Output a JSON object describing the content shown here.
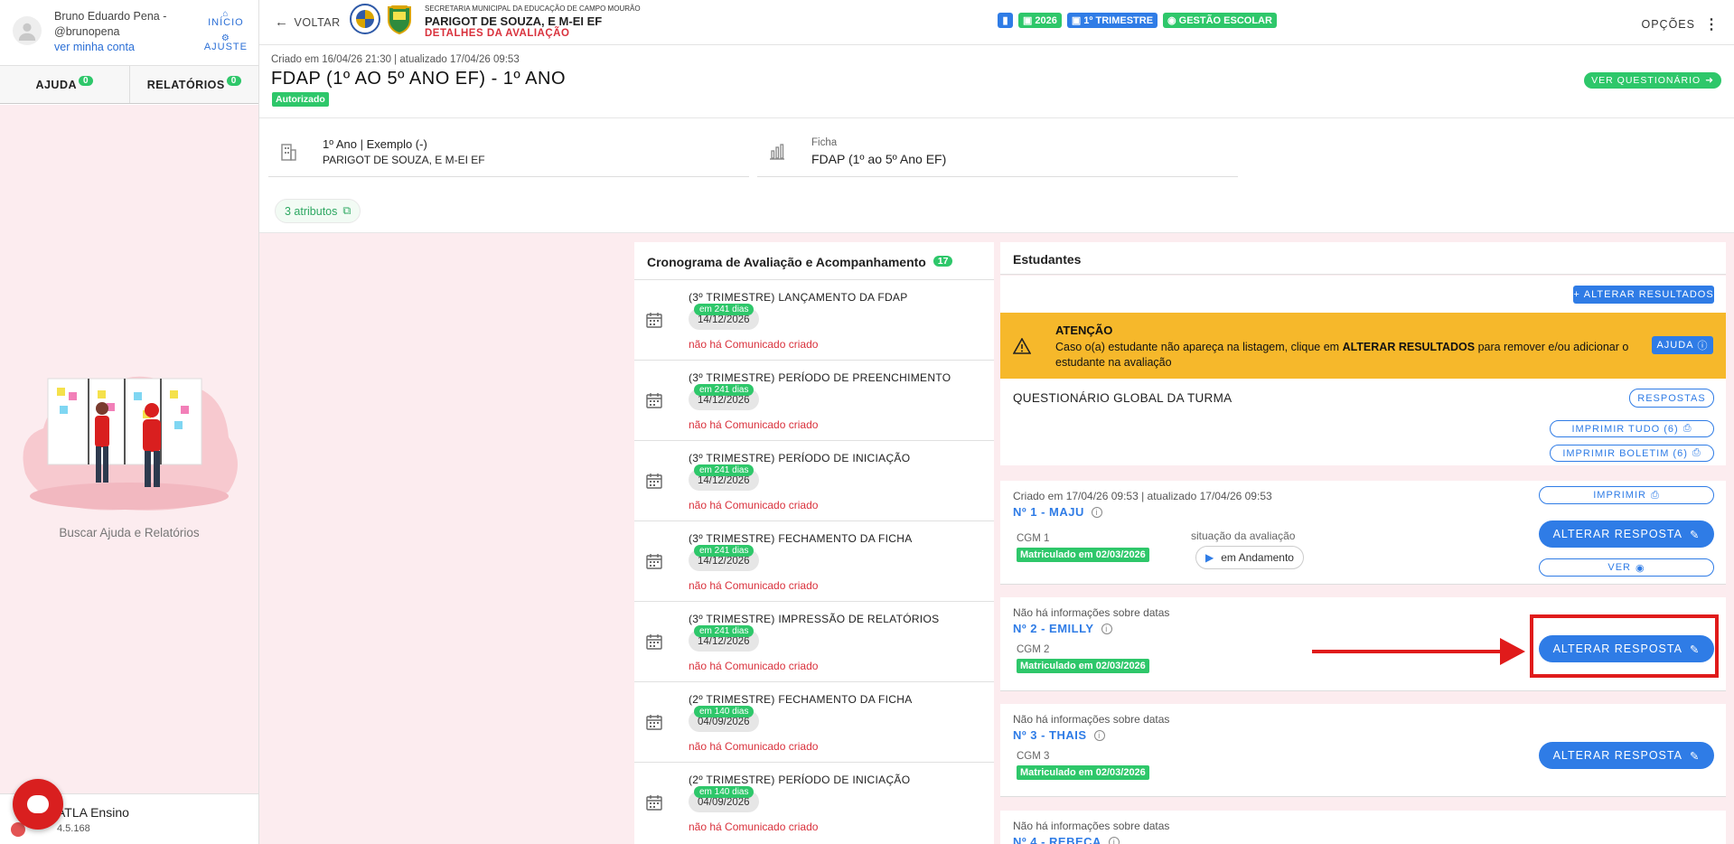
{
  "sidebar": {
    "user_name": "Bruno Eduardo Pena -",
    "user_handle": "@brunopena",
    "account_link": "ver minha conta",
    "inicio": "INÍCIO",
    "ajuste": "AJUSTE",
    "tabs": [
      {
        "label": "AJUDA",
        "count": "0"
      },
      {
        "label": "RELATÓRIOS",
        "count": "0"
      }
    ],
    "help_caption": "Buscar Ajuda e Relatórios",
    "app_name": "ATLA Ensino",
    "app_version": "4.5.168"
  },
  "topbar": {
    "back": "VOLTAR",
    "secretaria": "SECRETARIA MUNICIPAL DA EDUCAÇÃO DE CAMPO MOURÃO",
    "school": "PARIGOT DE SOUZA, E M-EI EF",
    "subtitle": "DETALHES DA AVALIAÇÃO",
    "chips": [
      "2026",
      "1º TRIMESTRE",
      "GESTÃO ESCOLAR"
    ],
    "options": "OPÇÕES"
  },
  "header": {
    "meta": "Criado em 16/04/26 21:30 | atualizado 17/04/26 09:53",
    "title": "FDAP (1º AO 5º ANO EF) - 1º ANO",
    "status": "Autorizado",
    "ver_questionario": "VER QUESTIONÁRIO"
  },
  "info": {
    "turma_line1": "1º Ano | Exemplo (-)",
    "turma_line2": "PARIGOT DE SOUZA, E M-EI EF",
    "ficha_label": "Ficha",
    "ficha_value": "FDAP (1º ao 5º Ano EF)",
    "attrs": "3 atributos"
  },
  "schedule": {
    "title": "Cronograma de Avaliação e Acompanhamento",
    "count": "17",
    "no_comm": "não há Comunicado criado",
    "items": [
      {
        "title": "(3º TRIMESTRE) LANÇAMENTO DA FDAP",
        "days": "em 241 dias",
        "date": "14/12/2026"
      },
      {
        "title": "(3º TRIMESTRE) PERÍODO DE PREENCHIMENTO",
        "days": "em 241 dias",
        "date": "14/12/2026"
      },
      {
        "title": "(3º TRIMESTRE) PERÍODO DE INICIAÇÃO",
        "days": "em 241 dias",
        "date": "14/12/2026"
      },
      {
        "title": "(3º TRIMESTRE) FECHAMENTO DA FICHA",
        "days": "em 241 dias",
        "date": "14/12/2026"
      },
      {
        "title": "(3º TRIMESTRE) IMPRESSÃO DE RELATÓRIOS",
        "days": "em 241 dias",
        "date": "14/12/2026"
      },
      {
        "title": "(2º TRIMESTRE) FECHAMENTO DA FICHA",
        "days": "em 140 dias",
        "date": "04/09/2026"
      },
      {
        "title": "(2º TRIMESTRE) PERÍODO DE INICIAÇÃO",
        "days": "em 140 dias",
        "date": "04/09/2026"
      }
    ]
  },
  "students": {
    "title": "Estudantes",
    "alter_results": "ALTERAR RESULTADOS",
    "alert_title": "ATENÇÃO",
    "alert_msg_pre": "Caso o(a) estudante não apareça na listagem, clique em ",
    "alert_msg_bold": "ALTERAR RESULTADOS",
    "alert_msg_post": " para remover e/ou adicionar o estudante na avaliação",
    "help": "AJUDA",
    "global_q": "QUESTIONÁRIO GLOBAL DA TURMA",
    "respostas": "RESPOSTAS",
    "print_all": "IMPRIMIR TUDO (6)",
    "print_boletim": "IMPRIMIR BOLETIM (6)",
    "imprimir": "IMPRIMIR",
    "alterar_resposta": "ALTERAR RESPOSTA",
    "ver": "VER",
    "situacao_label": "situação da avaliação",
    "situacao": "em Andamento",
    "list": [
      {
        "meta": "Criado em 17/04/26 09:53 | atualizado 17/04/26 09:53",
        "name": "Nº 1 - MAJU",
        "cgm": "CGM 1",
        "mat": "Matriculado em 02/03/2026"
      },
      {
        "meta": "Não há informações sobre datas",
        "name": "Nº 2 - EMILLY",
        "cgm": "CGM 2",
        "mat": "Matriculado em 02/03/2026"
      },
      {
        "meta": "Não há informações sobre datas",
        "name": "Nº 3 - THAIS",
        "cgm": "CGM 3",
        "mat": "Matriculado em 02/03/2026"
      },
      {
        "meta": "Não há informações sobre datas",
        "name": "Nº 4 - REBECA"
      }
    ]
  }
}
